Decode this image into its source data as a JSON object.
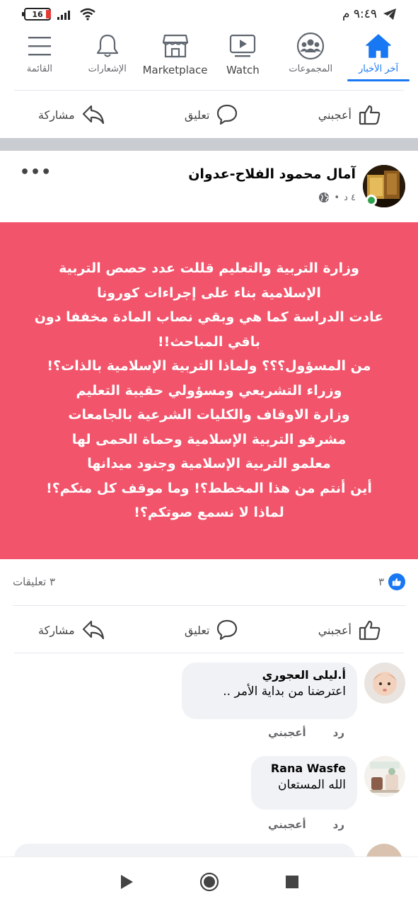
{
  "status_bar": {
    "time": "٩:٤٩ م",
    "battery": "16"
  },
  "nav": {
    "items": [
      {
        "label": "القائمة",
        "icon": "menu-icon"
      },
      {
        "label": "الإشعارات",
        "icon": "bell-icon"
      },
      {
        "label": "Marketplace",
        "icon": "shop-icon"
      },
      {
        "label": "Watch",
        "icon": "video-icon"
      },
      {
        "label": "المجموعات",
        "icon": "groups-icon"
      },
      {
        "label": "آخر الأخبار",
        "icon": "home-icon",
        "active": true
      }
    ]
  },
  "action_labels": {
    "share": "مشاركة",
    "comment": "تعليق",
    "like": "أعجبني"
  },
  "post": {
    "author": "آمال محمود الفلاح-عدوان",
    "time": "٤ د",
    "more": "•••",
    "lines": [
      "وزارة التربية والتعليم قللت عدد حصص التربية",
      "الإسلامية بناء على إجراءات كورونا",
      "عادت الدراسة كما هي وبقي نصاب المادة مخففا دون",
      "باقي المباحث!!",
      "من المسؤول؟؟؟ ولماذا التربية الإسلامية بالذات؟!",
      "وزراء التشريعي ومسؤولي حقيبة التعليم",
      "وزارة الاوقاف والكليات الشرعية بالجامعات",
      "مشرفو التربية الإسلامية وحماة الحمى لها",
      "معلمو التربية الإسلامية وجنود ميدانها",
      "أين أنتم من هذا المخطط؟! وما موقف كل منكم؟!",
      "لماذا لا نسمع صوتكم؟!"
    ],
    "bg_color": "#f2546b",
    "reaction_count": "٣",
    "comments_count": "٣ تعليقات"
  },
  "comments": [
    {
      "name": "أ.ليلى العجوري",
      "text": "اعترضنا من بداية الأمر ..",
      "like": "أعجبني",
      "reply": "رد"
    },
    {
      "name": "Rana Wasfe",
      "text": "الله المستعان",
      "like": "أعجبني",
      "reply": "رد"
    }
  ],
  "accent": "#1877f2"
}
